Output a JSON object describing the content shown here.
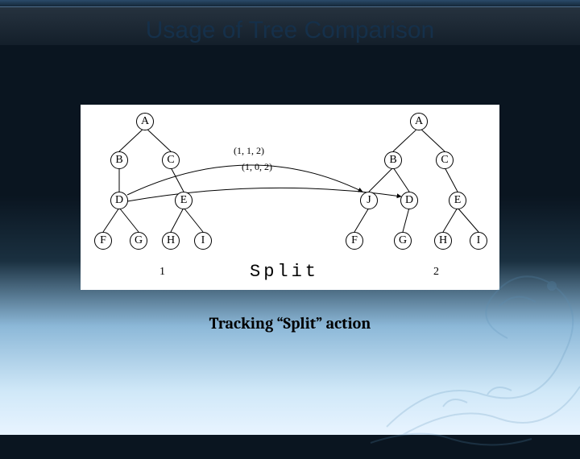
{
  "slide": {
    "title": "Usage of Tree Comparison",
    "caption": "Tracking “Split” action"
  },
  "diagram": {
    "operation_label": "Split",
    "tree1_label": "1",
    "tree2_label": "2",
    "tree1": {
      "nodes": [
        "A",
        "B",
        "C",
        "D",
        "E",
        "F",
        "G",
        "H",
        "I"
      ]
    },
    "tree2": {
      "nodes": [
        "A",
        "B",
        "C",
        "J",
        "D",
        "E",
        "F",
        "G",
        "H",
        "I"
      ]
    },
    "edge_annotations": [
      "(1, 1, 2)",
      "(1, 0, 2)"
    ]
  },
  "chart_data": {
    "type": "diagram",
    "title": "Usage of Tree Comparison",
    "operation": "Split",
    "trees": [
      {
        "id": 1,
        "edges": [
          [
            "A",
            "B"
          ],
          [
            "A",
            "C"
          ],
          [
            "B",
            "D"
          ],
          [
            "C",
            "E"
          ],
          [
            "D",
            "F"
          ],
          [
            "D",
            "G"
          ],
          [
            "E",
            "H"
          ],
          [
            "E",
            "I"
          ]
        ]
      },
      {
        "id": 2,
        "edges": [
          [
            "A",
            "B"
          ],
          [
            "A",
            "C"
          ],
          [
            "B",
            "J"
          ],
          [
            "B",
            "D"
          ],
          [
            "C",
            "E"
          ],
          [
            "J",
            "F"
          ],
          [
            "D",
            "G"
          ],
          [
            "E",
            "H"
          ],
          [
            "E",
            "I"
          ]
        ]
      }
    ],
    "mapping_arrows": [
      {
        "from_tree": 1,
        "from_node": "D",
        "to_tree": 2,
        "to_node": "J",
        "label": "(1, 1, 2)"
      },
      {
        "from_tree": 1,
        "from_node": "D",
        "to_tree": 2,
        "to_node": "D",
        "label": "(1, 0, 2)"
      }
    ]
  }
}
